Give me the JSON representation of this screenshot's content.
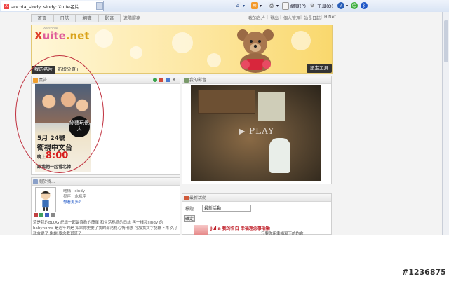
{
  "browser": {
    "tab_title": "anchia_sindy: sindy: Xuite名片",
    "menu_page": "網頁(P)",
    "menu_tools": "工具(O)"
  },
  "xuite_nav": {
    "tabs": [
      "首頁",
      "日誌",
      "相簿",
      "影音"
    ],
    "extra": "進階服務",
    "right_links": [
      "我的名片",
      "登出",
      "個人管理",
      "站長日誌",
      "HiNet"
    ]
  },
  "banner": {
    "logo_x": "X",
    "logo_rest": "uite",
    "logo_net": ".net",
    "logo_small": "Personal",
    "page_tabs": [
      "我的名片",
      "新增分頁+"
    ],
    "settings_label": "設定工具"
  },
  "ad_panel": {
    "title": "廣告",
    "mark_text": "綜藝玩很大",
    "date": "5月 24號",
    "channel": "衛視中文台",
    "time_prefix": "晚上",
    "time": "8:00",
    "tagline": "跟我們一起看北韓"
  },
  "video_panel": {
    "title": "我的影音",
    "play_label": "PLAY"
  },
  "about_panel": {
    "title": "關於我...",
    "line1": "暱稱：sindy",
    "line2": "星座：水瓶座",
    "line3": "想看更多?",
    "body": "這是我的BLOG 紀錄一起最喜歡的簡單 和生活點滴的日誌 再一樣和sindy 的babyhome 是週年的是 如果你更要了我的部落格心情用想 可加我文字記錄下來 久了就會變了 謝謝 要念我哥哥了"
  },
  "activity_panel": {
    "title": "最新活動",
    "label": "標題",
    "input_value": "最新活動",
    "button": "確定",
    "item_title": "Julia 我的告白 幸福理念事活動",
    "item_sub1": "只要你用幸福寫下的約會",
    "item_sub2": "就有機會獲得 精緻小禮品"
  },
  "watermark": "#1236875",
  "colors": {
    "accent_red": "#c0303e",
    "banner_yellow": "#f9d86d"
  }
}
